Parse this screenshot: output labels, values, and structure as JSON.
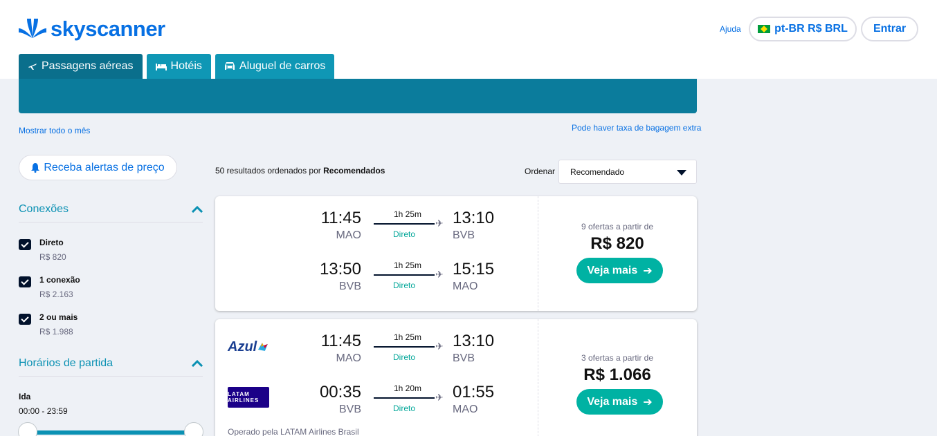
{
  "header": {
    "brand": "skyscanner",
    "help": "Ajuda",
    "locale": "pt-BR R$ BRL",
    "login": "Entrar"
  },
  "tabs": [
    {
      "label": "Passagens aéreas",
      "icon": "plane-icon",
      "active": true
    },
    {
      "label": "Hotéis",
      "icon": "bed-icon",
      "active": false
    },
    {
      "label": "Aluguel de carros",
      "icon": "car-icon",
      "active": false
    }
  ],
  "links": {
    "show_month": "Mostrar todo o mês",
    "bag_fee": "Pode haver taxa de bagagem extra"
  },
  "price_alert": "Receba alertas de preço",
  "filters": {
    "connections_title": "Conexões",
    "options": [
      {
        "label": "Direto",
        "price": "R$ 820",
        "checked": true
      },
      {
        "label": "1 conexão",
        "price": "R$ 2.163",
        "checked": true
      },
      {
        "label": "2 ou mais",
        "price": "R$ 1.988",
        "checked": true
      }
    ],
    "departure_title": "Horários de partida",
    "outbound_label": "Ida",
    "outbound_range": "00:00 - 23:59"
  },
  "results": {
    "count_prefix": "50 resultados ordenados por",
    "count_sort": "Recomendados",
    "order_label": "Ordenar",
    "order_value": "Recomendado"
  },
  "cards": [
    {
      "offers": "9 ofertas a partir de",
      "price": "R$ 820",
      "cta": "Veja mais",
      "legs": [
        {
          "airline": "",
          "dep_time": "11:45",
          "dep_code": "MAO",
          "duration": "1h 25m",
          "stops": "Direto",
          "arr_time": "13:10",
          "arr_code": "BVB"
        },
        {
          "airline": "",
          "dep_time": "13:50",
          "dep_code": "BVB",
          "duration": "1h 25m",
          "stops": "Direto",
          "arr_time": "15:15",
          "arr_code": "MAO"
        }
      ]
    },
    {
      "offers": "3 ofertas a partir de",
      "price": "R$ 1.066",
      "cta": "Veja mais",
      "operated_by": "Operado pela LATAM Airlines Brasil",
      "legs": [
        {
          "airline": "Azul",
          "dep_time": "11:45",
          "dep_code": "MAO",
          "duration": "1h 25m",
          "stops": "Direto",
          "arr_time": "13:10",
          "arr_code": "BVB"
        },
        {
          "airline": "LATAM AIRLINES",
          "dep_time": "00:35",
          "dep_code": "BVB",
          "duration": "1h 20m",
          "stops": "Direto",
          "arr_time": "01:55",
          "arr_code": "MAO"
        }
      ]
    }
  ],
  "colors": {
    "brand_blue": "#0770e3",
    "teal": "#0b91b3",
    "cta_green": "#00b2a3",
    "direct_green": "#00a698"
  }
}
